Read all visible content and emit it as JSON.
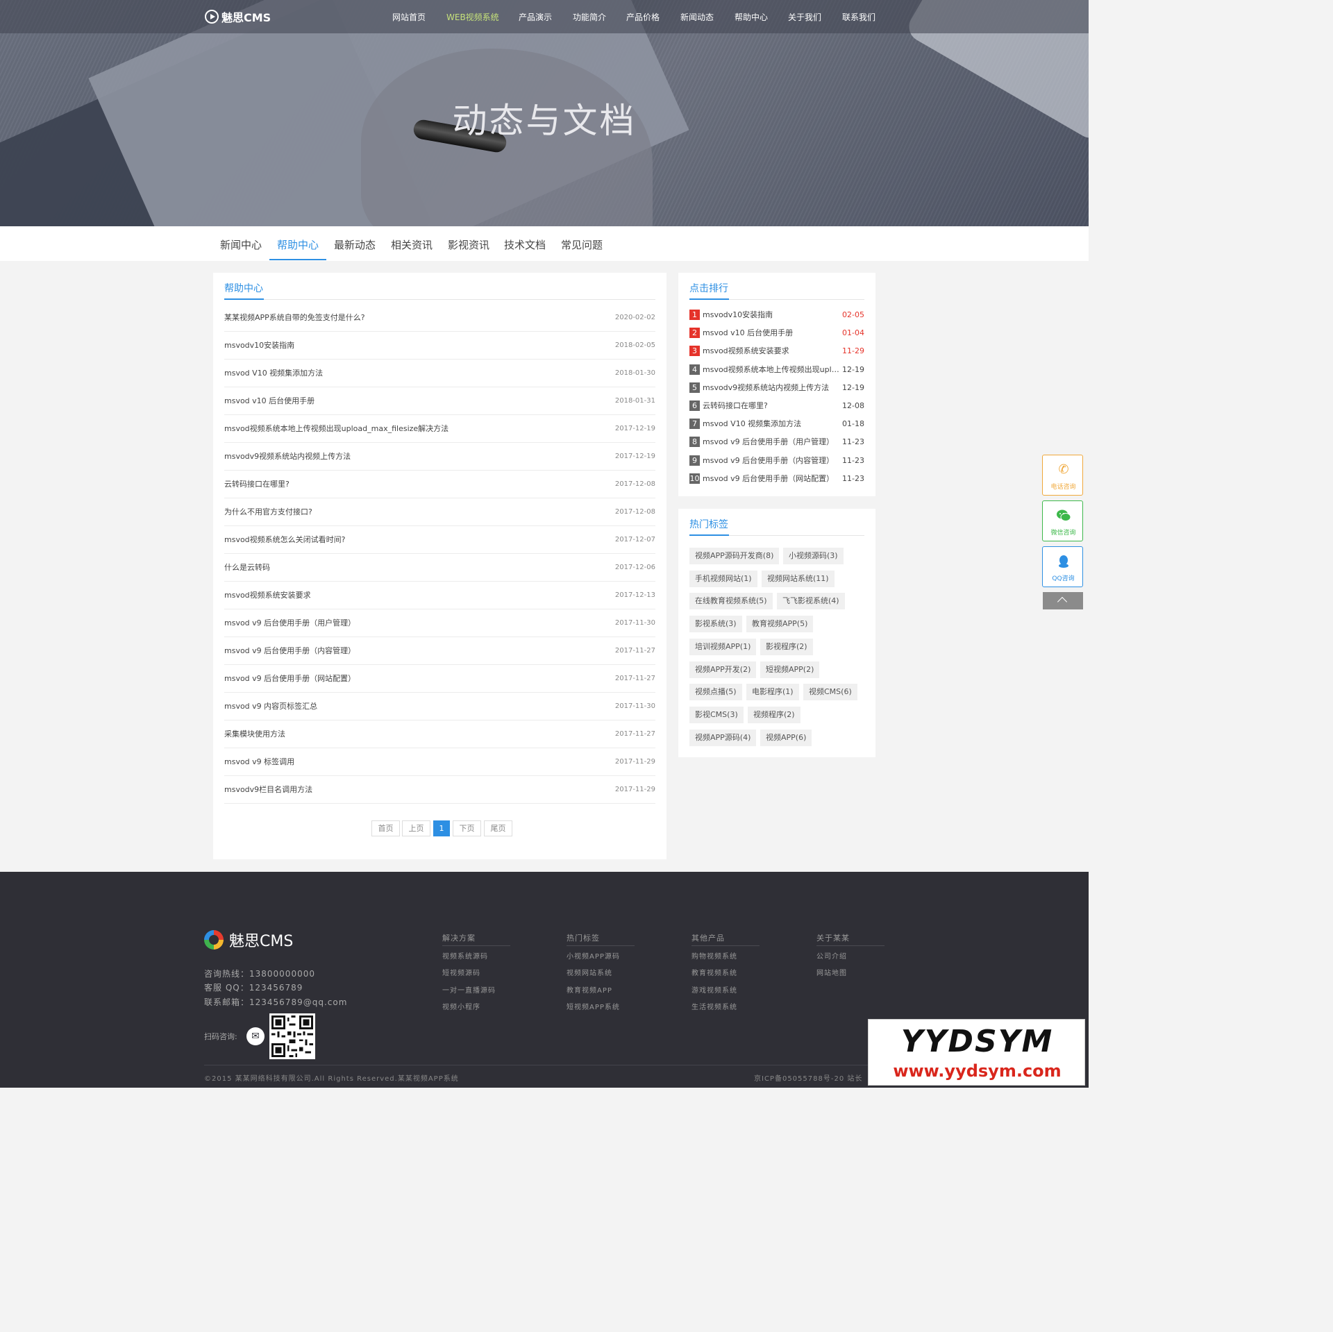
{
  "brand": {
    "logo_text": "魅思CMS"
  },
  "nav": {
    "items": [
      "网站首页",
      "WEB视频系统",
      "产品演示",
      "功能简介",
      "产品价格",
      "新闻动态",
      "帮助中心",
      "关于我们",
      "联系我们"
    ],
    "active_index": 1,
    "active_color": "#c6e27a"
  },
  "hero": {
    "title": "动态与文档"
  },
  "subtabs": {
    "items": [
      "新闻中心",
      "帮助中心",
      "最新动态",
      "相关资讯",
      "影视资讯",
      "技术文档",
      "常见问题"
    ],
    "active_index": 1
  },
  "main": {
    "heading": "帮助中心",
    "rows": [
      {
        "title": "某某视频APP系统自带的免签支付是什么?",
        "date": "2020-02-02"
      },
      {
        "title": "msvodv10安装指南",
        "date": "2018-02-05"
      },
      {
        "title": "msvod V10 视频集添加方法",
        "date": "2018-01-30"
      },
      {
        "title": "msvod v10 后台使用手册",
        "date": "2018-01-31"
      },
      {
        "title": "msvod视频系统本地上传视频出现upload_max_filesize解决方法",
        "date": "2017-12-19"
      },
      {
        "title": "msvodv9视频系统站内视频上传方法",
        "date": "2017-12-19"
      },
      {
        "title": "云转码接口在哪里?",
        "date": "2017-12-08"
      },
      {
        "title": "为什么不用官方支付接口?",
        "date": "2017-12-08"
      },
      {
        "title": "msvod视频系统怎么关闭试看时间?",
        "date": "2017-12-07"
      },
      {
        "title": "什么是云转码",
        "date": "2017-12-06"
      },
      {
        "title": "msvod视频系统安装要求",
        "date": "2017-12-13"
      },
      {
        "title": "msvod v9 后台使用手册（用户管理）",
        "date": "2017-11-30"
      },
      {
        "title": "msvod v9 后台使用手册（内容管理）",
        "date": "2017-11-27"
      },
      {
        "title": "msvod v9 后台使用手册（网站配置）",
        "date": "2017-11-27"
      },
      {
        "title": "msvod v9 内容页标签汇总",
        "date": "2017-11-30"
      },
      {
        "title": "采集模块使用方法",
        "date": "2017-11-27"
      },
      {
        "title": "msvod v9 标签调用",
        "date": "2017-11-29"
      },
      {
        "title": "msvodv9栏目名调用方法",
        "date": "2017-11-29"
      }
    ],
    "pager": {
      "first": "首页",
      "prev": "上页",
      "current": "1",
      "next": "下页",
      "last": "尾页"
    }
  },
  "ranking": {
    "heading": "点击排行",
    "items": [
      {
        "rank": "1",
        "title": "msvodv10安装指南",
        "date": "02-05"
      },
      {
        "rank": "2",
        "title": "msvod v10 后台使用手册",
        "date": "01-04"
      },
      {
        "rank": "3",
        "title": "msvod视频系统安装要求",
        "date": "11-29"
      },
      {
        "rank": "4",
        "title": "msvod视频系统本地上传视频出现upload_max_filesize解决方法",
        "date": "12-19"
      },
      {
        "rank": "5",
        "title": "msvodv9视频系统站内视频上传方法",
        "date": "12-19"
      },
      {
        "rank": "6",
        "title": "云转码接口在哪里?",
        "date": "12-08"
      },
      {
        "rank": "7",
        "title": "msvod V10 视频集添加方法",
        "date": "01-18"
      },
      {
        "rank": "8",
        "title": "msvod v9 后台使用手册（用户管理）",
        "date": "11-23"
      },
      {
        "rank": "9",
        "title": "msvod v9 后台使用手册（内容管理）",
        "date": "11-23"
      },
      {
        "rank": "10",
        "title": "msvod v9 后台使用手册（网站配置）",
        "date": "11-23"
      }
    ],
    "hot_color": "#e5332a"
  },
  "tags": {
    "heading": "热门标签",
    "items": [
      "视频APP源码开发商(8)",
      "小视频源码(3)",
      "手机视频网站(1)",
      "视频网站系统(11)",
      "在线教育视频系统(5)",
      "飞飞影视系统(4)",
      "影视系统(3)",
      "教育视频APP(5)",
      "培训视频APP(1)",
      "影视程序(2)",
      "视频APP开发(2)",
      "短视频APP(2)",
      "视频点播(5)",
      "电影程序(1)",
      "视频CMS(6)",
      "影视CMS(3)",
      "视频程序(2)",
      "视频APP源码(4)",
      "视频APP(6)"
    ]
  },
  "float": {
    "phone": {
      "icon": "phone-icon",
      "label": "电话咨询"
    },
    "wechat": {
      "icon": "wechat-icon",
      "label": "微信咨询"
    },
    "qq": {
      "icon": "qq-icon",
      "label": "QQ咨询"
    }
  },
  "footer": {
    "logo_text": "魅思CMS",
    "contact": [
      "咨询热线：13800000000",
      "客服 QQ：123456789",
      "联系邮箱：123456789@qq.com"
    ],
    "scan_label": "扫码咨询:",
    "columns": [
      {
        "heading": "解决方案",
        "links": [
          "视频系统源码",
          "短视频源码",
          "一对一直播源码",
          "视频小程序"
        ]
      },
      {
        "heading": "热门标签",
        "links": [
          "小视频APP源码",
          "视频网站系统",
          "教育视频APP",
          "短视频APP系统"
        ]
      },
      {
        "heading": "其他产品",
        "links": [
          "购物视频系统",
          "教育视频系统",
          "游戏视频系统",
          "生活视频系统"
        ]
      },
      {
        "heading": "关于某某",
        "links": [
          "公司介绍",
          "网站地图"
        ]
      }
    ],
    "copyright": "©2015 某某网络科技有限公司.All Rights Reserved.某某视频APP系统",
    "icp": "京ICP备05055788号-20  站长"
  },
  "watermark": {
    "line1": "YYDSYM",
    "line2": "www.yydsym.com"
  },
  "colors": {
    "accent": "#2d8fe3",
    "footer_bg": "#2f2f36"
  }
}
